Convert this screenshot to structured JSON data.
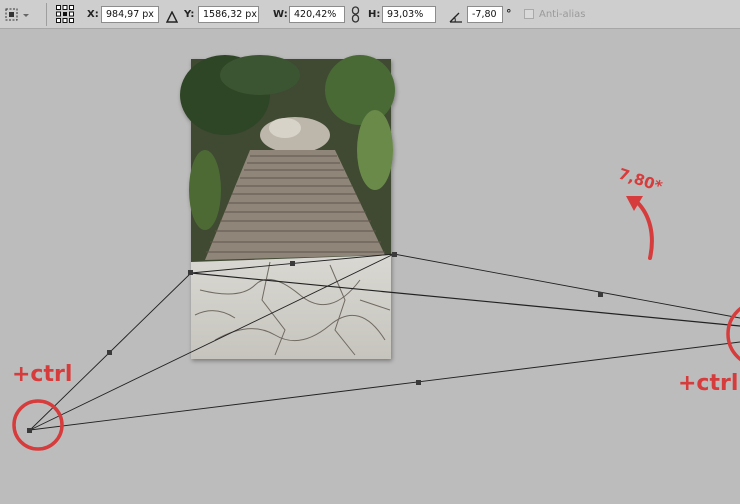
{
  "toolbar": {
    "tool_icon": "transform-marquee-icon",
    "reference_point_icon": "reference-point-grid-icon",
    "x_label": "X:",
    "x_value": "984,97 px",
    "delta_icon": "relative-position-triangle-icon",
    "y_label": "Y:",
    "y_value": "1586,32 px",
    "w_label": "W:",
    "w_value": "420,42%",
    "link_icon": "link-chain-icon",
    "h_label": "H:",
    "h_value": "93,03%",
    "angle_icon": "rotate-angle-icon",
    "angle_value": "-7,80",
    "angle_unit": "°",
    "antialias_label": "Anti-alias",
    "antialias_checked": false
  },
  "annotations": {
    "angle_note": "7,80*",
    "ctrl_left": "+ctrl",
    "ctrl_right": "+ctrl",
    "color": "#d63c3c"
  },
  "colors": {
    "canvas_bg": "#bcbcbc",
    "toolbar_bg": "#cecece"
  }
}
